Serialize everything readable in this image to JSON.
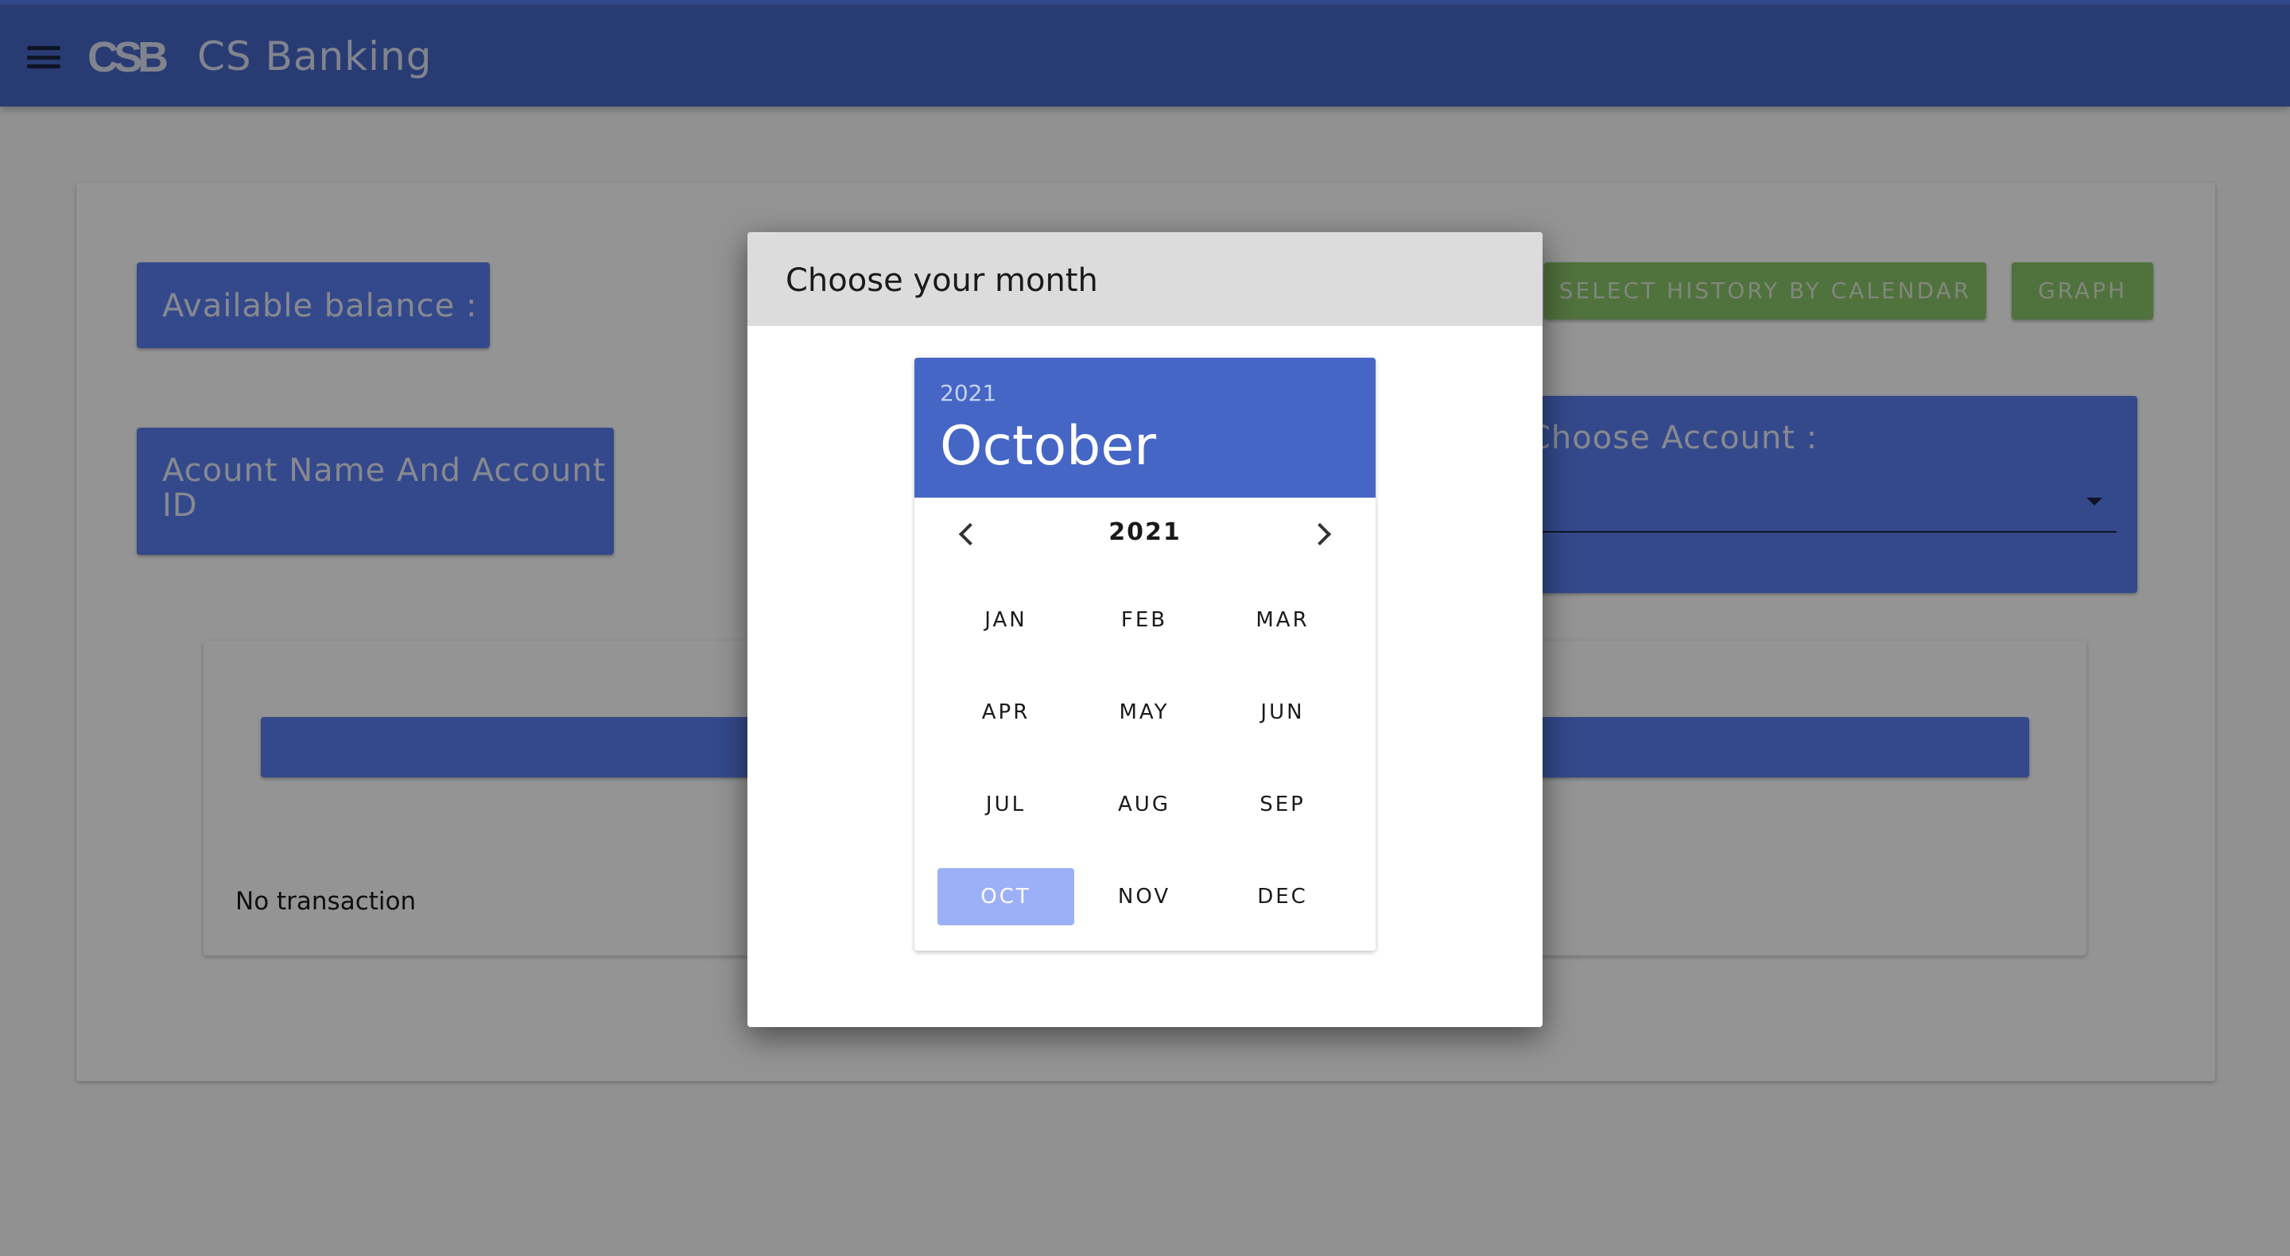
{
  "app": {
    "title": "CS Banking",
    "logo_text": "CSB"
  },
  "dashboard": {
    "balance_label": "Available balance :",
    "account_label": "Acount Name And Account ID",
    "history_button": "SELECT HISTORY BY CALENDAR",
    "graph_button": "GRAPH",
    "choose_account_label": "Choose Account :",
    "no_transaction": "No transaction"
  },
  "dialog": {
    "title": "Choose your month",
    "picker": {
      "selected_year": "2021",
      "selected_month": "October",
      "nav_year": "2021",
      "months": [
        "JAN",
        "FEB",
        "MAR",
        "APR",
        "MAY",
        "JUN",
        "JUL",
        "AUG",
        "SEP",
        "OCT",
        "NOV",
        "DEC"
      ],
      "selected_index": 9
    }
  },
  "colors": {
    "primary": "#4666c6",
    "accent": "#5b7ef0",
    "success": "#8bc46a",
    "selected_month": "#9bb0f7"
  }
}
